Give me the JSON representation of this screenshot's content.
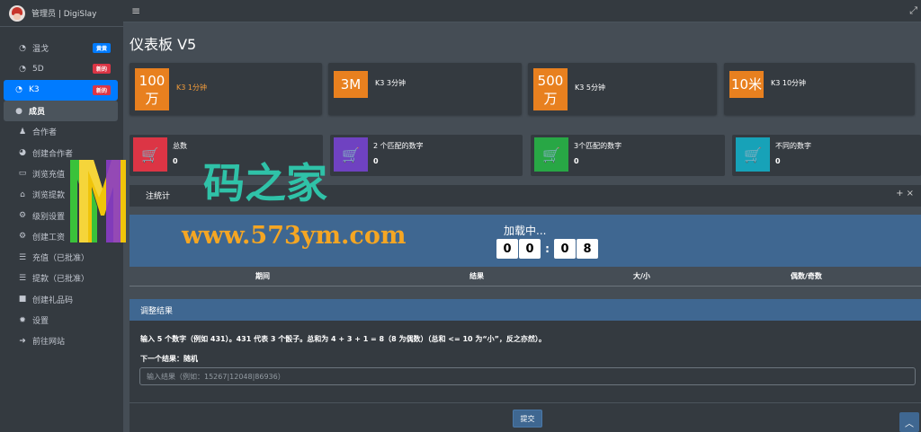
{
  "brand": {
    "title": "管理员 | DigiSlay"
  },
  "sidebar": {
    "items": [
      {
        "label": "温戈",
        "icon": "tachometer-icon",
        "badge": "黄黄",
        "badge_color": "#007bff"
      },
      {
        "label": "5D",
        "icon": "tachometer-icon",
        "badge": "新的",
        "badge_color": "#dc3545"
      },
      {
        "label": "K3",
        "icon": "tachometer-icon",
        "badge": "新的",
        "badge_color": "#dc3545"
      },
      {
        "label": "成员",
        "icon": "user-circle-icon"
      },
      {
        "label": "合作者",
        "icon": "users-icon"
      },
      {
        "label": "创建合作者",
        "icon": "pie-chart-icon"
      },
      {
        "label": "浏览充值",
        "icon": "credit-card-icon"
      },
      {
        "label": "浏览提款",
        "icon": "bank-icon"
      },
      {
        "label": "级别设置",
        "icon": "cogs-icon"
      },
      {
        "label": "创建工资",
        "icon": "cogs-icon"
      },
      {
        "label": "充值（已批准）",
        "icon": "list-icon"
      },
      {
        "label": "提款（已批准）",
        "icon": "list-icon"
      },
      {
        "label": "创建礼品码",
        "icon": "gift-icon"
      },
      {
        "label": "设置",
        "icon": "gear-icon"
      },
      {
        "label": "前往网站",
        "icon": "sign-out-icon"
      }
    ]
  },
  "header": {
    "menu_icon": "≡",
    "expand_icon": "⤢"
  },
  "page": {
    "title": "仪表板 V5"
  },
  "games": [
    {
      "box": "100万",
      "label": "K3 1分钟",
      "color": "#e8801f"
    },
    {
      "box": "3M",
      "label": "K3 3分钟",
      "color": "#e8801f"
    },
    {
      "box": "500万",
      "label": "K3 5分钟",
      "color": "#e8801f"
    },
    {
      "box": "10米",
      "label": "K3 10分钟",
      "color": "#e8801f"
    }
  ],
  "info_boxes": [
    {
      "title": "总数",
      "value": "0",
      "color": "#dc3545"
    },
    {
      "title": "2 个匹配的数字",
      "value": "0",
      "color": "#6f42c1"
    },
    {
      "title": "3个匹配的数字",
      "value": "0",
      "color": "#28a745"
    },
    {
      "title": "不同的数字",
      "value": "0",
      "color": "#17a2b8"
    }
  ],
  "stats_card": {
    "title": "注统计",
    "tools": "+  ×",
    "loading": "加载中...",
    "timer": {
      "min_tens": "0",
      "min_ones": "0",
      "sec_tens": "0",
      "sec_ones": "8"
    },
    "columns": [
      "期间",
      "结果",
      "大/小",
      "偶数/奇数"
    ]
  },
  "adjust": {
    "title": "调整结果",
    "description": "输入 5 个数字（例如 431）。431 代表 3 个骰子。总和为 4 + 3 + 1 = 8（8 为偶数）（总和 <= 10 为“小”，反之亦然）。",
    "next_result": "下一个结果：随机",
    "input_placeholder": "输入结果（例如：15267|12048|86936）",
    "submit_label": "提交"
  },
  "watermark": {
    "text": "码之家",
    "url": "www.573ym.com"
  },
  "colors": {
    "accent": "#007bff",
    "panel": "#3f6791",
    "orange": "#e8801f"
  }
}
